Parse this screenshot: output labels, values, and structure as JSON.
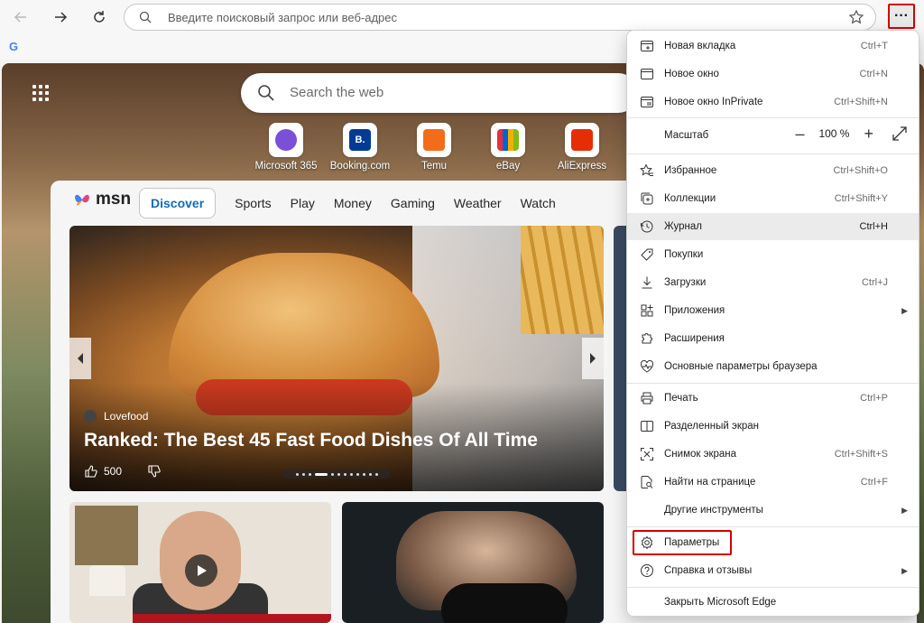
{
  "toolbar": {
    "address_placeholder": "Введите поисковый запрос или веб-адрес",
    "more_label": "···"
  },
  "ntp": {
    "search_placeholder": "Search the web",
    "tiles": [
      {
        "label": "Microsoft 365",
        "color": "#7b4fd6"
      },
      {
        "label": "Booking.com",
        "color": "#003b95"
      },
      {
        "label": "Temu",
        "color": "#f36c1a"
      },
      {
        "label": "eBay",
        "color": "#e53238"
      },
      {
        "label": "AliExpress",
        "color": "#e62e04"
      }
    ]
  },
  "msn": {
    "logo": "msn",
    "nav": [
      "Discover",
      "Sports",
      "Play",
      "Money",
      "Gaming",
      "Weather",
      "Watch"
    ],
    "hero": {
      "source": "Lovefood",
      "title": "Ranked: The Best 45 Fast Food Dishes Of All Time",
      "likes": "500"
    }
  },
  "menu": {
    "items": [
      {
        "label": "Новая вкладка",
        "shortcut": "Ctrl+T",
        "icon": "new-tab-icon"
      },
      {
        "label": "Новое окно",
        "shortcut": "Ctrl+N",
        "icon": "new-window-icon"
      },
      {
        "label": "Новое окно InPrivate",
        "shortcut": "Ctrl+Shift+N",
        "icon": "inprivate-icon"
      },
      {
        "label": "Масштаб",
        "zoom": "100 %",
        "icon": "zoom-icon"
      },
      {
        "label": "Избранное",
        "shortcut": "Ctrl+Shift+O",
        "icon": "favorites-icon"
      },
      {
        "label": "Коллекции",
        "shortcut": "Ctrl+Shift+Y",
        "icon": "collections-icon"
      },
      {
        "label": "Журнал",
        "shortcut": "Ctrl+H",
        "icon": "history-icon"
      },
      {
        "label": "Покупки",
        "shortcut": "",
        "icon": "shopping-icon"
      },
      {
        "label": "Загрузки",
        "shortcut": "Ctrl+J",
        "icon": "downloads-icon"
      },
      {
        "label": "Приложения",
        "shortcut": "",
        "icon": "apps-icon"
      },
      {
        "label": "Расширения",
        "shortcut": "",
        "icon": "extensions-icon"
      },
      {
        "label": "Основные параметры браузера",
        "shortcut": "",
        "icon": "browser-essentials-icon"
      },
      {
        "label": "Печать",
        "shortcut": "Ctrl+P",
        "icon": "print-icon"
      },
      {
        "label": "Разделенный экран",
        "shortcut": "",
        "icon": "split-screen-icon"
      },
      {
        "label": "Снимок экрана",
        "shortcut": "Ctrl+Shift+S",
        "icon": "screenshot-icon"
      },
      {
        "label": "Найти на странице",
        "shortcut": "Ctrl+F",
        "icon": "find-icon"
      },
      {
        "label": "Другие инструменты",
        "shortcut": "",
        "icon": "more-tools-icon"
      },
      {
        "label": "Параметры",
        "shortcut": "",
        "icon": "settings-icon"
      },
      {
        "label": "Справка и отзывы",
        "shortcut": "",
        "icon": "help-icon"
      },
      {
        "label": "Закрыть Microsoft Edge",
        "shortcut": "",
        "icon": "close-edge-icon"
      }
    ]
  }
}
